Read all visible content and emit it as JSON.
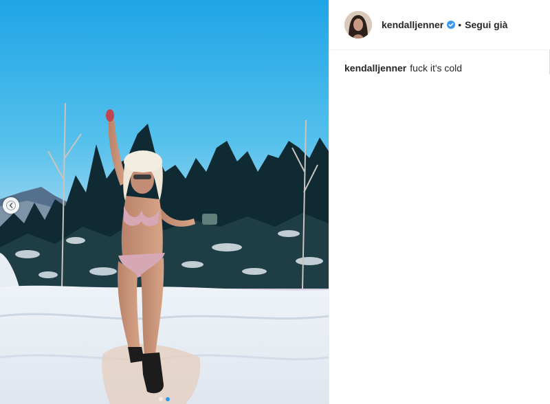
{
  "post": {
    "username": "kendalljenner",
    "verified": true,
    "separator": "•",
    "follow_status": "Segui già",
    "caption": {
      "username": "kendalljenner",
      "text": "fuck it's cold"
    }
  },
  "carousel": {
    "prev_icon": "chevron-left-icon",
    "slide_count": 2,
    "active_slide": 1
  },
  "colors": {
    "verified_badge": "#3897f0",
    "active_dot": "#2c96ea",
    "divider": "#efefef"
  }
}
